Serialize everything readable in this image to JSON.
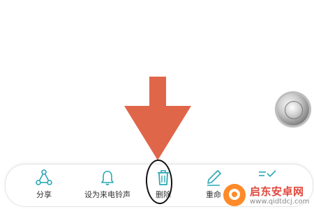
{
  "actions": [
    {
      "label": "分享",
      "icon": "share-icon"
    },
    {
      "label": "设为来电铃声",
      "icon": "bell-icon"
    },
    {
      "label": "删除",
      "icon": "trash-icon"
    },
    {
      "label": "重命",
      "icon": "pen-icon"
    },
    {
      "label": "",
      "icon": "more-icon"
    }
  ],
  "annotation": {
    "arrow_color": "#e0664a",
    "circle_color": "#111111"
  },
  "colors": {
    "icon_accent": "#2aa8b6",
    "label": "#333333"
  },
  "watermark": {
    "title": "启东安卓网",
    "url": "www.qidtdcj.com",
    "logo_color": "#ff8a2a"
  }
}
